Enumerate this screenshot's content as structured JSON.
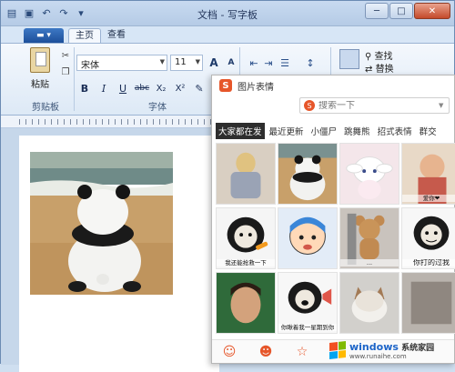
{
  "window": {
    "title": "文档 - 写字板",
    "minimize": "─",
    "maximize": "□",
    "close": "✕"
  },
  "ribbon": {
    "app_menu": "▬ ▾",
    "tabs": [
      {
        "label": "主页",
        "active": true
      },
      {
        "label": "查看",
        "active": false
      }
    ],
    "clipboard": {
      "paste_label": "粘贴",
      "group_label": "剪贴板"
    },
    "font": {
      "family": "宋体",
      "size": "11",
      "grow": "A",
      "shrink": "A",
      "bold": "B",
      "italic": "I",
      "underline": "U",
      "strike": "abc",
      "subscript": "X₂",
      "superscript": "X²",
      "group_label": "字体"
    },
    "editing": {
      "find": "查找",
      "replace": "替换"
    }
  },
  "emoji_panel": {
    "title": "图片表情",
    "search_placeholder": "搜索一下",
    "categories": [
      {
        "label": "大家都在发",
        "active": true
      },
      {
        "label": "最近更新",
        "active": false
      },
      {
        "label": "小僵尸",
        "active": false
      },
      {
        "label": "跳舞熊",
        "active": false
      },
      {
        "label": "招式表情",
        "active": false
      },
      {
        "label": "群交",
        "active": false
      }
    ],
    "captions": {
      "c1_4": "爱你❤",
      "c2_1": "我还能抢救一下",
      "c2_3": "...",
      "c2_4": "你打的过我",
      "c3_2": "你瞅着我一星期到你"
    }
  },
  "watermark": {
    "brand": "windows",
    "site": "系统家园",
    "url": "www.runaihe.com"
  },
  "colors": {
    "accent_orange": "#e6562a",
    "ribbon_blue": "#1d4f9a",
    "window_bg": "#d7e6f6"
  }
}
